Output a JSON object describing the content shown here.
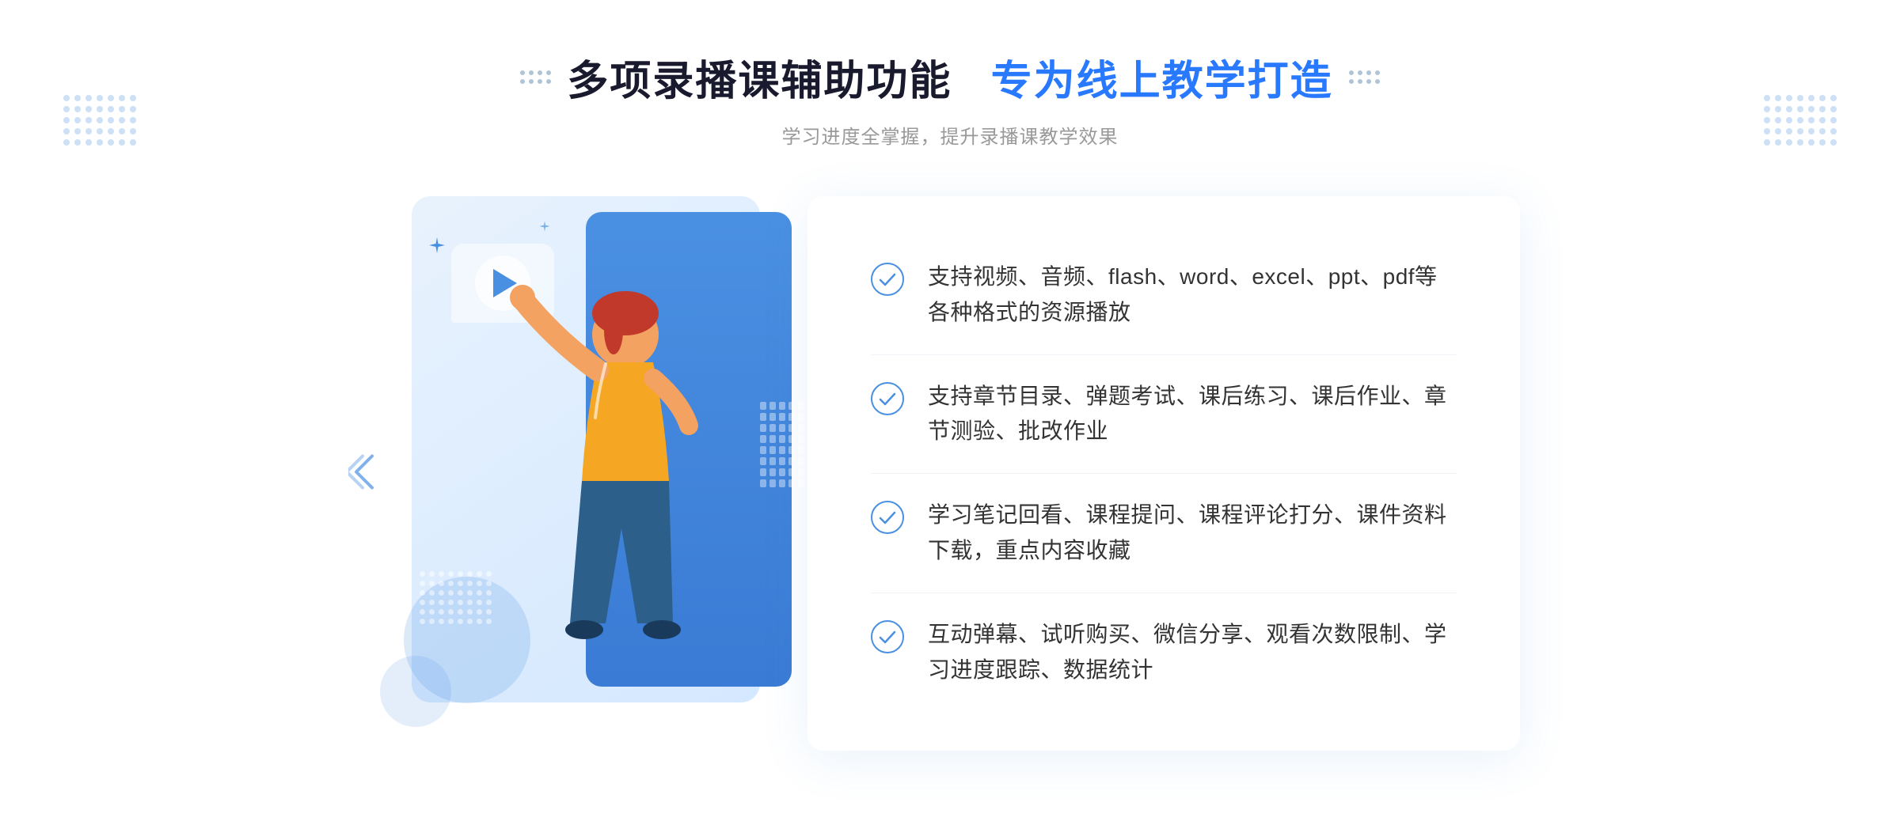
{
  "header": {
    "title_main": "多项录播课辅助功能 专为线上教学打造",
    "title_part1": "多项录播课辅助功能",
    "title_part2": "专为线上教学打造",
    "subtitle": "学习进度全掌握，提升录播课教学效果"
  },
  "features": [
    {
      "id": 1,
      "text": "支持视频、音频、flash、word、excel、ppt、pdf等各种格式的资源播放"
    },
    {
      "id": 2,
      "text": "支持章节目录、弹题考试、课后练习、课后作业、章节测验、批改作业"
    },
    {
      "id": 3,
      "text": "学习笔记回看、课程提问、课程评论打分、课件资料下载，重点内容收藏"
    },
    {
      "id": 4,
      "text": "互动弹幕、试听购买、微信分享、观看次数限制、学习进度跟踪、数据统计"
    }
  ],
  "colors": {
    "primary": "#2979ff",
    "primary_light": "#4a90e2",
    "text_dark": "#1a1a2e",
    "text_gray": "#999999",
    "text_feature": "#333333",
    "bg_card": "#e8f2fd",
    "check_color": "#4a90e2"
  }
}
